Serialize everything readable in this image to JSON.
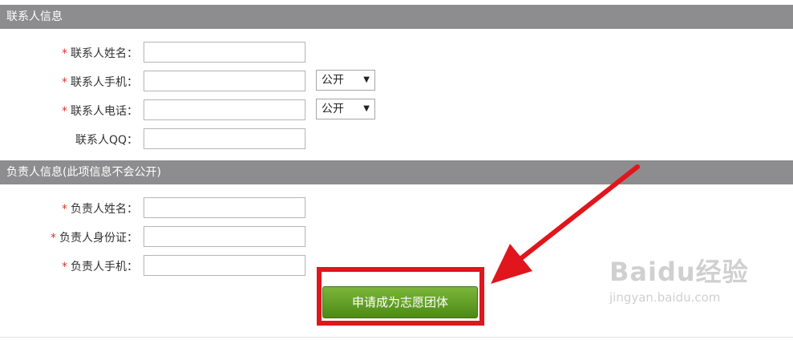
{
  "contact_section": {
    "title": "联系人信息",
    "rows": [
      {
        "required": "*",
        "label": "联系人姓名：",
        "value": ""
      },
      {
        "required": "*",
        "label": "联系人手机：",
        "value": "",
        "visibility": "公开"
      },
      {
        "required": "*",
        "label": "联系人电话：",
        "value": "",
        "visibility": "公开"
      },
      {
        "required": "",
        "label": "联系人QQ：",
        "value": ""
      }
    ]
  },
  "owner_section": {
    "title": "负责人信息(此项信息不会公开)",
    "rows": [
      {
        "required": "*",
        "label": "负责人姓名：",
        "value": ""
      },
      {
        "required": "*",
        "label": "负责人身份证：",
        "value": ""
      },
      {
        "required": "*",
        "label": "负责人手机：",
        "value": ""
      }
    ]
  },
  "submit": {
    "label": "申请成为志愿团体"
  },
  "watermark": {
    "logo": "Baidu经验",
    "url": "jingyan.baidu.com"
  },
  "colors": {
    "header_bg": "#8d8c8e",
    "required": "#e0322b",
    "button": "#5a9a22",
    "highlight": "#e0161c"
  },
  "icons": {
    "select_arrow": "caret-down-icon"
  }
}
